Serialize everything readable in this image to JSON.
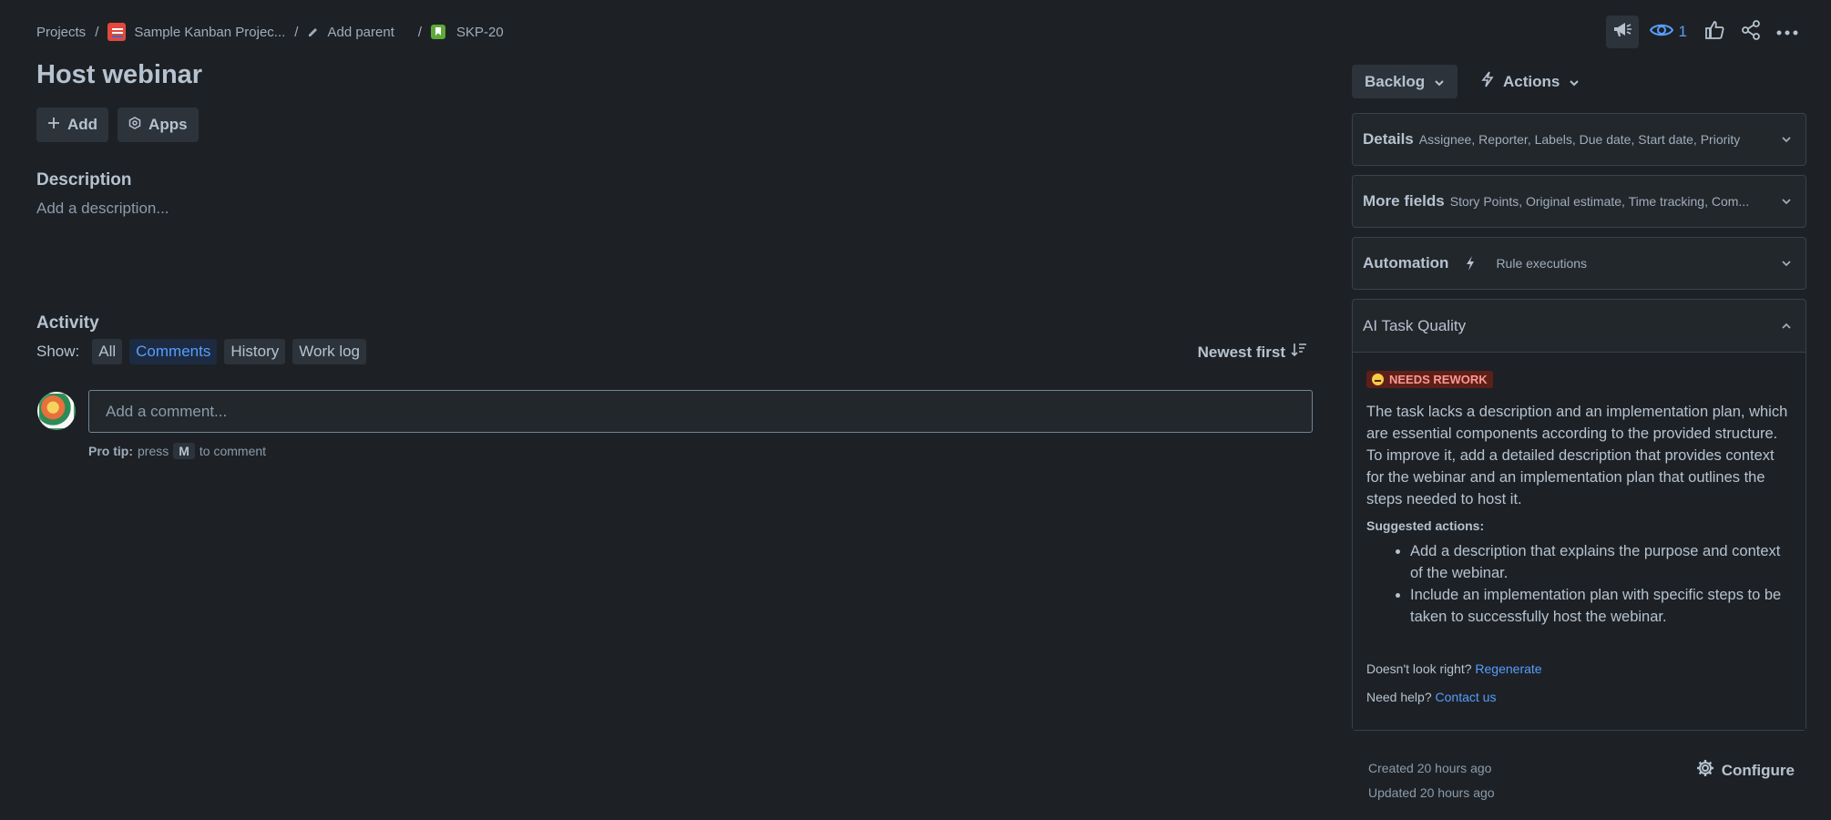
{
  "breadcrumb": {
    "projects": "Projects",
    "project_name": "Sample Kanban Projec...",
    "add_parent": "Add parent",
    "issue_key": "SKP-20"
  },
  "toolbar": {
    "watch_count": "1"
  },
  "issue": {
    "title": "Host webinar",
    "add_label": "Add",
    "apps_label": "Apps",
    "description_heading": "Description",
    "description_placeholder": "Add a description..."
  },
  "activity": {
    "heading": "Activity",
    "show_label": "Show:",
    "filters": [
      "All",
      "Comments",
      "History",
      "Work log"
    ],
    "selected_filter": "Comments",
    "sort_label": "Newest first",
    "comment_placeholder": "Add a comment...",
    "protip_bold": "Pro tip:",
    "protip_press": "press",
    "protip_key": "M",
    "protip_rest": "to comment"
  },
  "sidebar": {
    "status_label": "Backlog",
    "actions_label": "Actions",
    "panels": [
      {
        "title": "Details",
        "subtitle": "Assignee, Reporter, Labels, Due date, Start date, Priority"
      },
      {
        "title": "More fields",
        "subtitle": "Story Points, Original estimate, Time tracking, Com..."
      },
      {
        "title": "Automation",
        "subtitle": "Rule executions"
      }
    ],
    "ai": {
      "title": "AI Task Quality",
      "badge": "NEEDS REWORK",
      "summary": "The task lacks a description and an implementation plan, which are essential components according to the provided structure. To improve it, add a detailed description that provides context for the webinar and an implementation plan that outlines the steps needed to host it.",
      "suggested_heading": "Suggested actions:",
      "suggestions": [
        "Add a description that explains the purpose and context of the webinar.",
        "Include an implementation plan with specific steps to be taken to successfully host the webinar."
      ],
      "doesnt_look_right": "Doesn't look right?",
      "regenerate": "Regenerate",
      "need_help": "Need help?",
      "contact": "Contact us"
    },
    "created": "Created 20 hours ago",
    "updated": "Updated 20 hours ago",
    "configure": "Configure"
  },
  "colors": {
    "background": "#1d2125",
    "accent": "#579dff",
    "badge_bg": "#5d1f1a",
    "badge_text": "#fd9891"
  }
}
